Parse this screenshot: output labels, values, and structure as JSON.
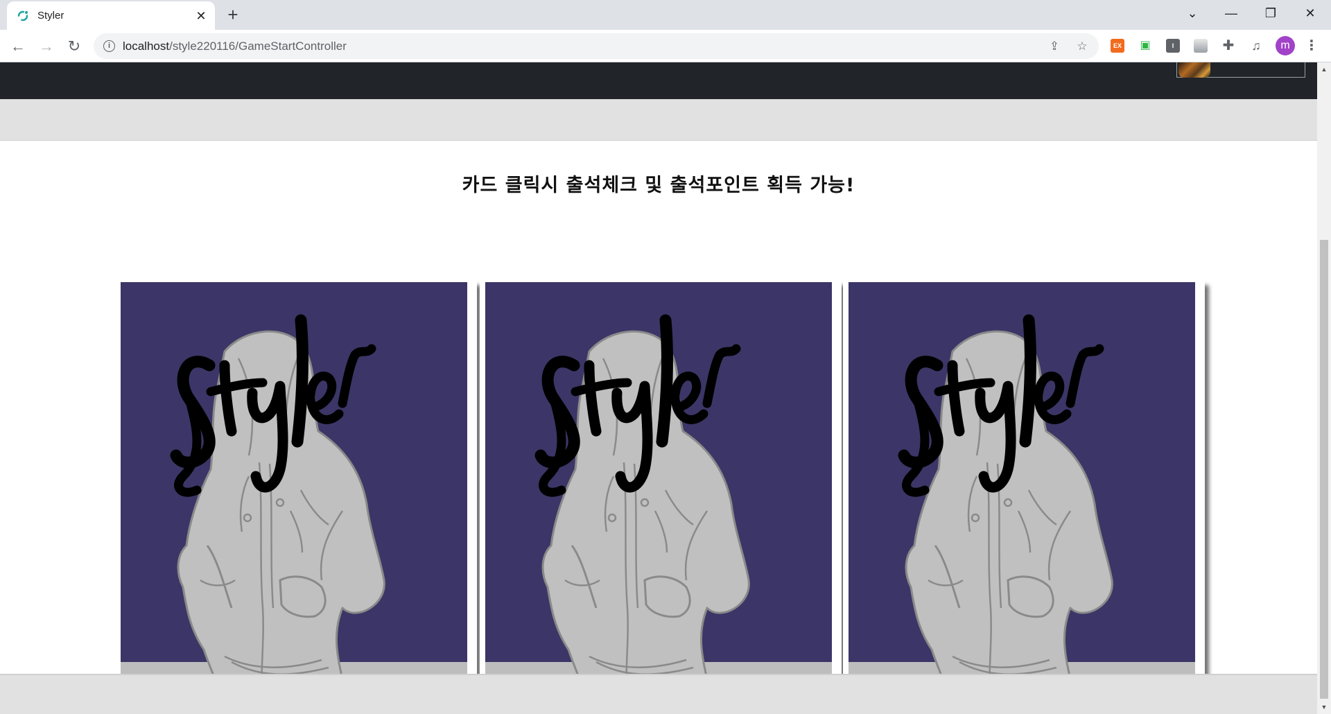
{
  "browser": {
    "tab_title": "Styler",
    "tab_close": "✕",
    "new_tab": "+",
    "url_host": "localhost",
    "url_path": "/style220116/GameStartController",
    "window_controls": {
      "tab_search": "⌄",
      "minimize": "—",
      "restore": "❐",
      "close": "✕"
    },
    "nav": {
      "back": "←",
      "forward": "→",
      "reload": "↻"
    },
    "extensions": [
      {
        "name": "ex-extension",
        "label": "EX",
        "color": "#f26b1d"
      },
      {
        "name": "green-extension",
        "label": "▣",
        "color": "#2fb544"
      },
      {
        "name": "i-extension",
        "label": "I",
        "color": "#5f6368"
      },
      {
        "name": "photo-extension",
        "label": "",
        "color": "#9aa0a6"
      }
    ],
    "profile_initial": "m"
  },
  "page": {
    "notice": "카드 클릭시 출석체크 및 출석포인트 획득 가능!",
    "cards": [
      {
        "logo_text": "Styler"
      },
      {
        "logo_text": "Styler"
      },
      {
        "logo_text": "Styler"
      }
    ],
    "colors": {
      "card_background": "#3b3667",
      "figure": "#c0c0c0",
      "figure_outline": "#8a8a8a",
      "floor": "#bdbdbd",
      "header": "#212529"
    }
  }
}
